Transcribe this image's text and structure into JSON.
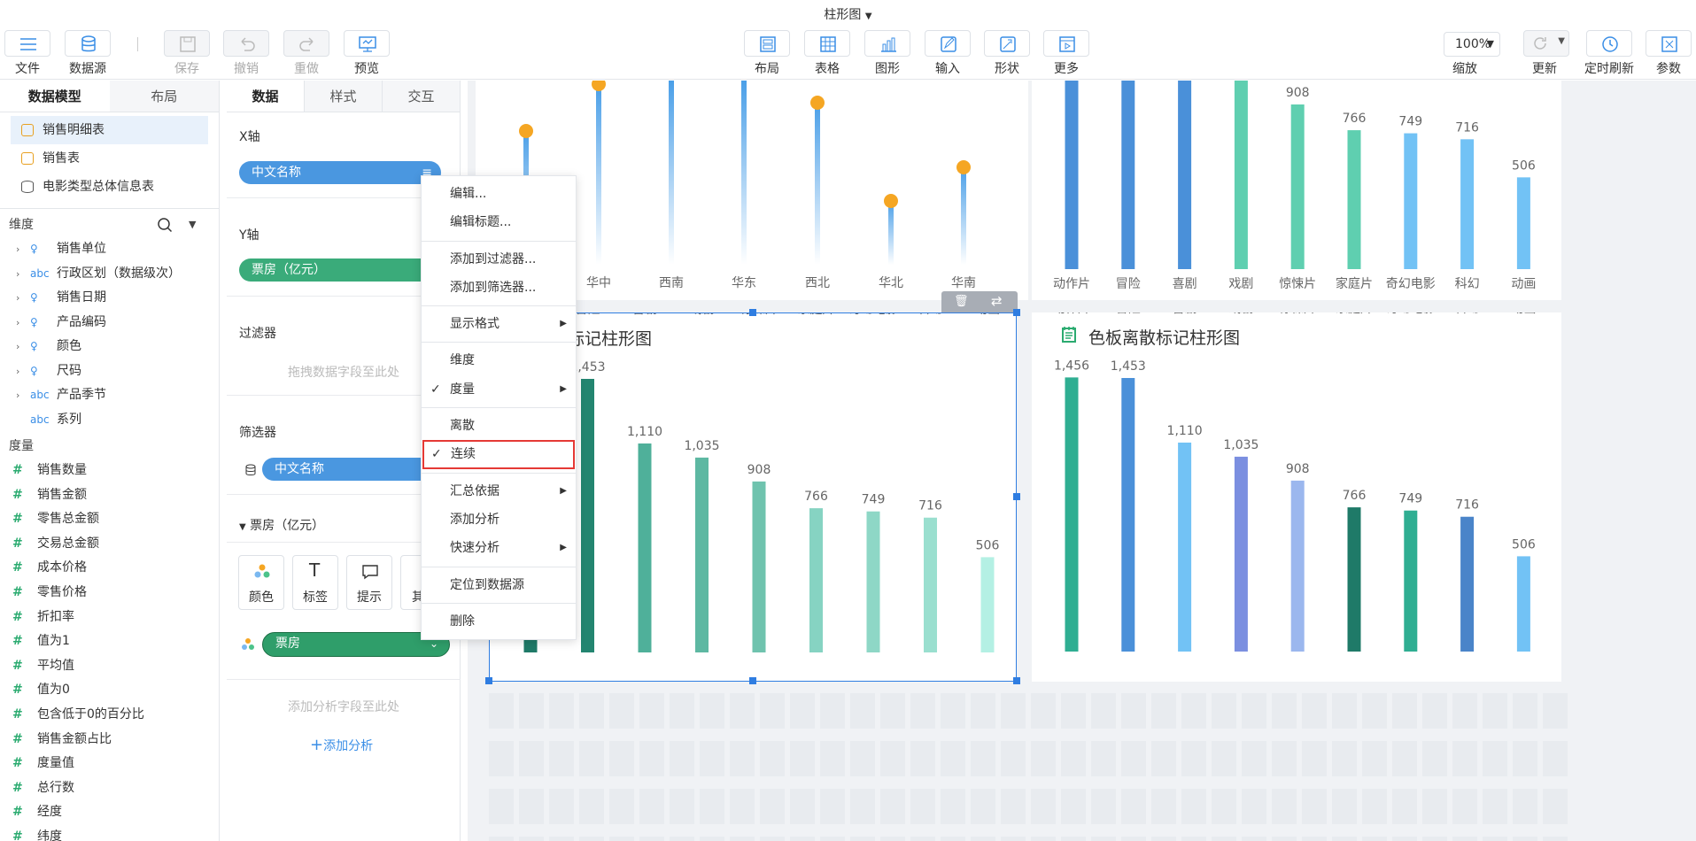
{
  "doc_title": "柱形图",
  "toolbar": {
    "left": [
      {
        "label": "文件",
        "icon": "menu-icon",
        "disabled": false
      },
      {
        "label": "数据源",
        "icon": "database-icon",
        "disabled": false
      },
      {
        "label": "保存",
        "icon": "save-icon",
        "disabled": true
      },
      {
        "label": "撤销",
        "icon": "undo-icon",
        "disabled": true
      },
      {
        "label": "重做",
        "icon": "redo-icon",
        "disabled": true
      },
      {
        "label": "预览",
        "icon": "preview-icon",
        "disabled": false
      }
    ],
    "center": [
      {
        "label": "布局",
        "icon": "layout-icon"
      },
      {
        "label": "表格",
        "icon": "table-icon"
      },
      {
        "label": "图形",
        "icon": "bar-chart-icon"
      },
      {
        "label": "输入",
        "icon": "edit-icon"
      },
      {
        "label": "形状",
        "icon": "shape-icon"
      },
      {
        "label": "更多",
        "icon": "play-icon"
      }
    ],
    "right": [
      {
        "label": "缩放",
        "value": "100%"
      },
      {
        "label": "更新",
        "icon": "refresh-icon"
      },
      {
        "label": "定时刷新",
        "icon": "clock-icon"
      },
      {
        "label": "参数",
        "icon": "parameter-icon"
      }
    ]
  },
  "left_panel": {
    "tabs": [
      "数据模型",
      "布局"
    ],
    "tables": [
      "销售明细表",
      "销售表",
      "电影类型总体信息表"
    ],
    "dimension_header": "维度",
    "dimensions": [
      {
        "label": "销售单位",
        "type": "geo"
      },
      {
        "label": "行政区划（数据级次）",
        "type": "abc"
      },
      {
        "label": "销售日期",
        "type": "geo"
      },
      {
        "label": "产品编码",
        "type": "geo"
      },
      {
        "label": "颜色",
        "type": "geo"
      },
      {
        "label": "尺码",
        "type": "geo"
      },
      {
        "label": "产品季节",
        "type": "abc"
      },
      {
        "label": "系列",
        "type": "abc"
      }
    ],
    "measure_header": "度量",
    "measures": [
      "销售数量",
      "销售金额",
      "零售总金额",
      "交易总金额",
      "成本价格",
      "零售价格",
      "折扣率",
      "值为1",
      "平均值",
      "值为0",
      "包含低于0的百分比",
      "销售金额占比",
      "度量值",
      "总行数",
      "经度",
      "纬度"
    ]
  },
  "mid_panel": {
    "tabs": [
      "数据",
      "样式",
      "交互"
    ],
    "x_axis_label": "X轴",
    "x_axis_field": "中文名称",
    "y_axis_label": "Y轴",
    "y_axis_field": "票房（亿元）",
    "filter_label": "过滤器",
    "filter_hint": "拖拽数据字段至此处",
    "screener_label": "筛选器",
    "screener_field": "中文名称",
    "measure_section": "票房（亿元）",
    "mark_buttons": [
      "颜色",
      "标签",
      "提示",
      "其"
    ],
    "color_field": "票房",
    "analysis_hint": "添加分析字段至此处",
    "add_analysis": "添加分析"
  },
  "charts": {
    "top_left_categories": [
      "华中",
      "西南",
      "华东",
      "西北",
      "华北",
      "华南"
    ],
    "selected_title": "连续标记柱形图",
    "right_title": "色板离散标记柱形图",
    "colors": {
      "blue1": "#4a90d9",
      "teal1": "#5fcfb0",
      "lightblue": "#72c2f5",
      "dark_teal": "#1f7a68"
    }
  },
  "chart_data": [
    {
      "type": "bar",
      "title": "连续标记柱形图",
      "categories": [
        "动作片",
        "冒险",
        "喜剧",
        "戏剧",
        "惊悚片",
        "家庭片",
        "奇幻电影",
        "科幻",
        "动画"
      ],
      "values": [
        1456,
        1453,
        1110,
        1035,
        908,
        766,
        749,
        716,
        506
      ],
      "data_labels": [
        "",
        "1,453",
        "1,110",
        "1,035",
        "908",
        "766",
        "749",
        "716",
        "506"
      ]
    },
    {
      "type": "bar",
      "title": "色板离散标记柱形图",
      "categories": [
        "动作片",
        "冒险",
        "喜剧",
        "戏剧",
        "惊悚片",
        "家庭片",
        "奇幻电影",
        "科幻",
        "动画"
      ],
      "values": [
        1456,
        1453,
        1110,
        1035,
        908,
        766,
        749,
        716,
        506
      ],
      "data_labels": [
        "1,456",
        "1,453",
        "1,110",
        "1,035",
        "908",
        "766",
        "749",
        "716",
        "506"
      ]
    },
    {
      "type": "bar",
      "categories": [
        "动作片",
        "冒险",
        "喜剧",
        "戏剧",
        "惊悚片",
        "家庭片",
        "奇幻电影",
        "科幻",
        "动画"
      ],
      "values": [
        1456,
        1453,
        1110,
        1035,
        908,
        766,
        749,
        716,
        506
      ],
      "data_labels": [
        "",
        "",
        "",
        "",
        "908",
        "766",
        "749",
        "716",
        "506"
      ]
    }
  ],
  "context_menu": {
    "items": [
      {
        "label": "编辑...",
        "submenu": false,
        "checked": false
      },
      {
        "label": "编辑标题...",
        "submenu": false,
        "checked": false
      },
      {
        "sep": true
      },
      {
        "label": "添加到过滤器...",
        "submenu": false,
        "checked": false
      },
      {
        "label": "添加到筛选器...",
        "submenu": false,
        "checked": false
      },
      {
        "sep": true
      },
      {
        "label": "显示格式",
        "submenu": true,
        "checked": false
      },
      {
        "sep": true
      },
      {
        "label": "维度",
        "submenu": false,
        "checked": false
      },
      {
        "label": "度量",
        "submenu": true,
        "checked": true
      },
      {
        "sep": true
      },
      {
        "label": "离散",
        "submenu": false,
        "checked": false
      },
      {
        "label": "连续",
        "submenu": false,
        "checked": true,
        "highlight": true
      },
      {
        "sep": true
      },
      {
        "label": "汇总依据",
        "submenu": true,
        "checked": false
      },
      {
        "label": "添加分析",
        "submenu": false,
        "checked": false
      },
      {
        "label": "快速分析",
        "submenu": true,
        "checked": false
      },
      {
        "sep": true
      },
      {
        "label": "定位到数据源",
        "submenu": false,
        "checked": false
      },
      {
        "sep": true
      },
      {
        "label": "删除",
        "submenu": false,
        "checked": false
      }
    ]
  }
}
